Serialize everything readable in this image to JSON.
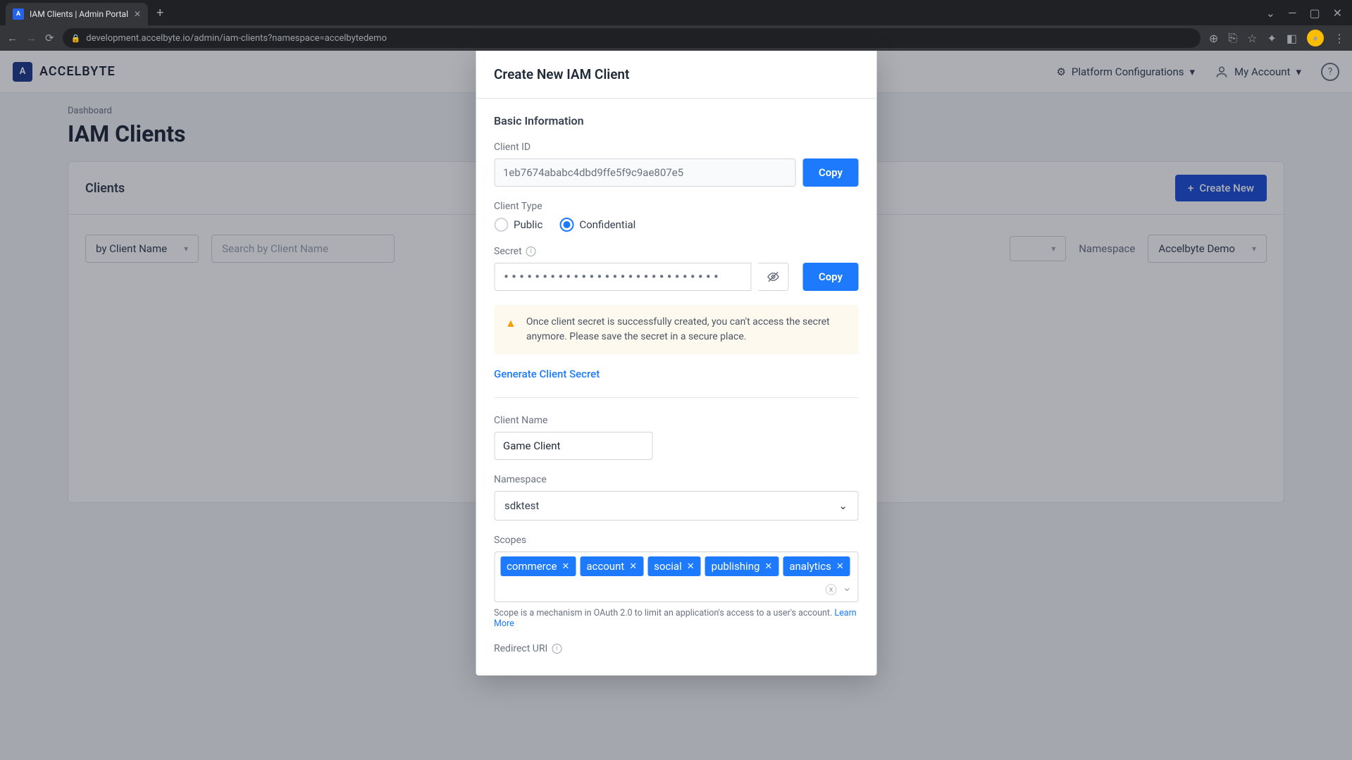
{
  "browser": {
    "tab_title": "IAM Clients | Admin Portal",
    "url": "development.accelbyte.io/admin/iam-clients?namespace=accelbytedemo"
  },
  "header": {
    "logo": "ACCELBYTE",
    "platform_config": "Platform Configurations",
    "my_account": "My Account"
  },
  "page": {
    "breadcrumb": "Dashboard",
    "title": "IAM Clients"
  },
  "card": {
    "title": "Clients",
    "create_btn": "Create New",
    "filter_by": "by Client Name",
    "search_placeholder": "Search by Client Name",
    "namespace_label": "Namespace",
    "namespace_value": "Accelbyte Demo"
  },
  "modal": {
    "title": "Create New IAM Client",
    "section_basic": "Basic Information",
    "client_id_label": "Client ID",
    "client_id_value": "1eb7674ababc4dbd9ffe5f9c9ae807e5",
    "copy": "Copy",
    "client_type_label": "Client Type",
    "radio_public": "Public",
    "radio_confidential": "Confidential",
    "secret_label": "Secret",
    "secret_value": "••••••••••••••••••••••••••••",
    "alert": "Once client secret is successfully created, you can't access the secret anymore. Please save the secret in a secure place.",
    "generate_link": "Generate Client Secret",
    "client_name_label": "Client Name",
    "client_name_value": "Game Client",
    "namespace_label": "Namespace",
    "namespace_value": "sdktest",
    "scopes_label": "Scopes",
    "scopes": [
      "commerce",
      "account",
      "social",
      "publishing",
      "analytics"
    ],
    "scopes_helper": "Scope is a mechanism in OAuth 2.0 to limit an application's access to a user's account.",
    "learn_more": "Learn More",
    "redirect_uri_label": "Redirect URI"
  }
}
